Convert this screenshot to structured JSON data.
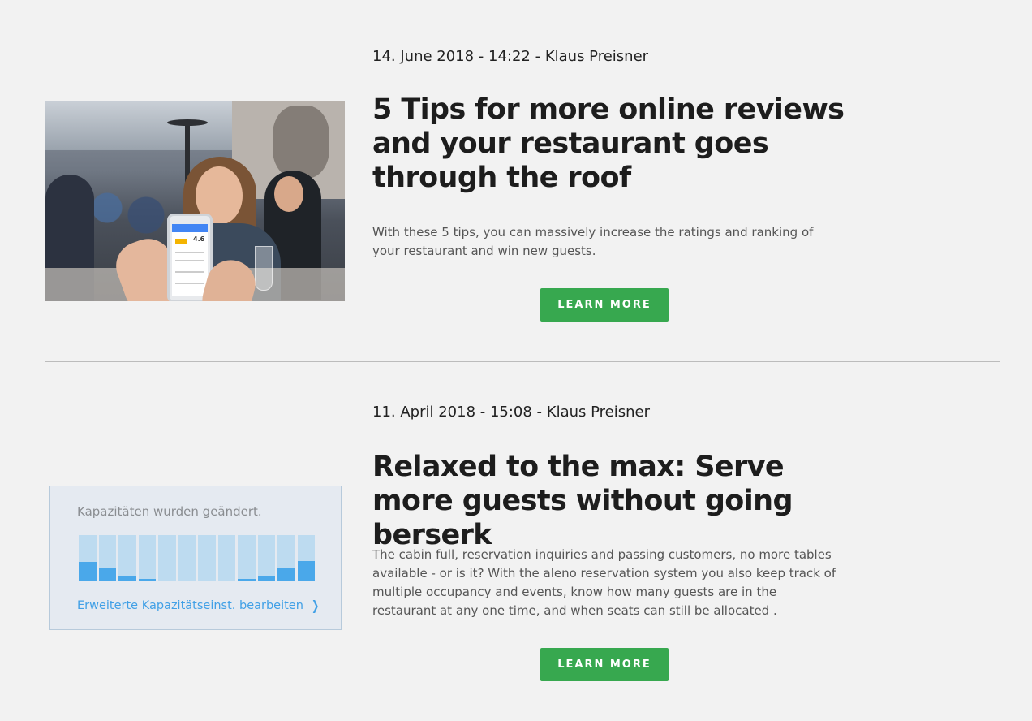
{
  "posts": [
    {
      "meta": "14. June 2018 - 14:22 - Klaus Preisner",
      "title": "5 Tips for more online reviews and your restaurant goes through the roof",
      "excerpt": "With these 5 tips, you can massively increase the ratings and ranking of your restaurant and win new guests.",
      "button_label": "LEARN MORE",
      "image": {
        "phone_rating": "4.6"
      }
    },
    {
      "meta": "11. April 2018 - 15:08 - Klaus Preisner",
      "title": "Relaxed to the max: Serve more guests without going berserk",
      "excerpt": "The cabin full, reservation inquiries and passing customers, no more tables available - or is it? With the aleno reservation system you also keep track of multiple occupancy and events, know how many guests are in the restaurant at any one time, and when seats can still be allocated .",
      "button_label": "LEARN MORE",
      "capacity": {
        "title": "Kapazitäten wurden geändert.",
        "link_label": "Erweiterte Kapazitätseinst. bearbeiten",
        "bar_levels": [
          0.42,
          0.3,
          0.12,
          0.05,
          0,
          0,
          0,
          0,
          0.05,
          0.12,
          0.3,
          0.44
        ]
      }
    }
  ],
  "colors": {
    "background": "#f2f2f2",
    "button": "#37a84f",
    "capacity_fill": "#4aa8ea",
    "capacity_empty": "#bddbf0",
    "link": "#41a0e6"
  }
}
